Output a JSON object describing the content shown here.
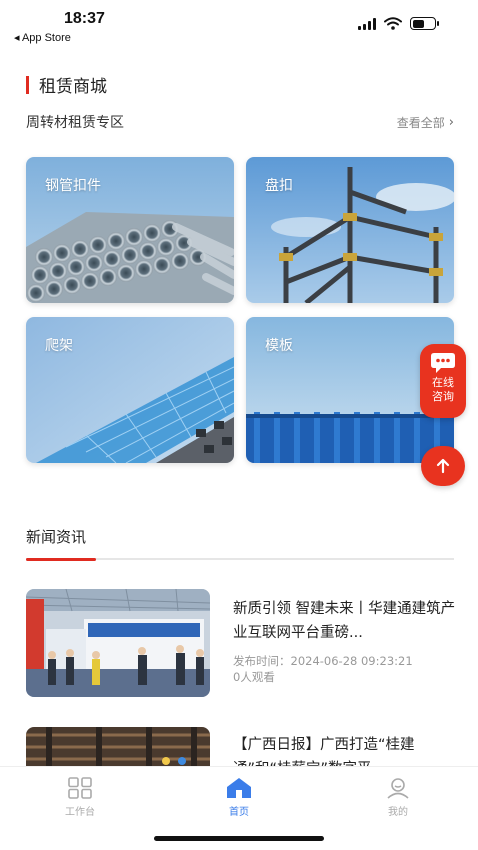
{
  "status": {
    "time": "18:37",
    "back_app": "◂ App Store"
  },
  "section": {
    "title": "租赁商城",
    "subtitle": "周转材租赁专区",
    "view_all": "查看全部"
  },
  "categories": [
    {
      "label": "钢管扣件"
    },
    {
      "label": "盘扣"
    },
    {
      "label": "爬架"
    },
    {
      "label": "模板"
    }
  ],
  "floating": {
    "consult_label": "在线咨询"
  },
  "news": {
    "heading": "新闻资讯",
    "items": [
      {
        "title": "新质引领 智建未来丨华建通建筑产业互联网平台重磅...",
        "publish_label": "发布时间：",
        "publish_time": "2024-06-28 09:23:21",
        "views": "0人观看"
      },
      {
        "title": "【广西日报】广西打造“桂建通”和“桂薪宝”数字平..."
      }
    ]
  },
  "tabbar": {
    "items": [
      {
        "label": "工作台",
        "icon": "grid-icon"
      },
      {
        "label": "首页",
        "icon": "home-icon"
      },
      {
        "label": "我的",
        "icon": "user-icon"
      }
    ],
    "active_color": "#3b7de9",
    "inactive_color": "#aaaaaa"
  },
  "colors": {
    "accent": "#e02b20",
    "float_button": "#e8331f"
  }
}
